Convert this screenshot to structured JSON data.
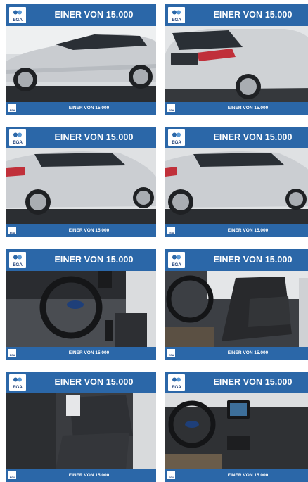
{
  "banner_title": "EINER VON 15.000",
  "brand_logo_text": "EGA",
  "colors": {
    "banner_blue": "#2b67a8",
    "logo_navy": "#1d3f78"
  },
  "gallery": [
    {
      "title": "EINER VON 15.000",
      "footer": "EINER VON 15.000",
      "scene": "side-front"
    },
    {
      "title": "EINER VON 15.000",
      "footer": "EINER VON 15.000",
      "scene": "rear-three-quarter"
    },
    {
      "title": "EINER VON 15.000",
      "footer": "EINER VON 15.000",
      "scene": "side-rear"
    },
    {
      "title": "EINER VON 15.000",
      "footer": "EINER VON 15.000",
      "scene": "side-rear"
    },
    {
      "title": "EINER VON 15.000",
      "footer": "EINER VON 15.000",
      "scene": "interior-dash"
    },
    {
      "title": "EINER VON 15.000",
      "footer": "EINER VON 15.000",
      "scene": "front-seats"
    },
    {
      "title": "EINER VON 15.000",
      "footer": "EINER VON 15.000",
      "scene": "rear-seat"
    },
    {
      "title": "EINER VON 15.000",
      "footer": "EINER VON 15.000",
      "scene": "dashboard"
    }
  ]
}
